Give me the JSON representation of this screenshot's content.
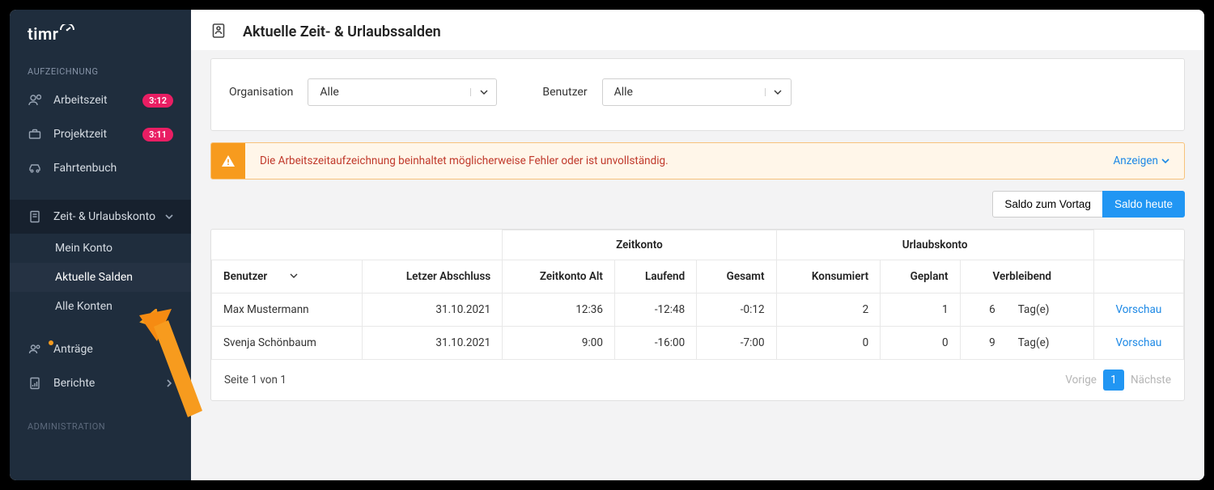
{
  "brand": "timr",
  "sidebar": {
    "sections": {
      "recording": "AUFZEICHNUNG",
      "administration": "ADMINISTRATION"
    },
    "items": {
      "arbeitszeit": {
        "label": "Arbeitszeit",
        "badge": "3:12"
      },
      "projektzeit": {
        "label": "Projektzeit",
        "badge": "3:11"
      },
      "fahrtenbuch": {
        "label": "Fahrtenbuch"
      },
      "zeit_urlaub": {
        "label": "Zeit- & Urlaubskonto"
      },
      "sub_mein_konto": {
        "label": "Mein Konto"
      },
      "sub_aktuelle_salden": {
        "label": "Aktuelle Salden"
      },
      "sub_alle_konten": {
        "label": "Alle Konten"
      },
      "antraege": {
        "label": "Anträge"
      },
      "berichte": {
        "label": "Berichte"
      }
    }
  },
  "page": {
    "title": "Aktuelle Zeit- & Urlaubssalden"
  },
  "filters": {
    "organisation_label": "Organisation",
    "organisation_value": "Alle",
    "benutzer_label": "Benutzer",
    "benutzer_value": "Alle"
  },
  "alert": {
    "message": "Die Arbeitszeitaufzeichnung beinhaltet möglicherweise Fehler oder ist unvollständig.",
    "action": "Anzeigen"
  },
  "toggle": {
    "prev": "Saldo zum Vortag",
    "today": "Saldo heute"
  },
  "table": {
    "group_zeit": "Zeitkonto",
    "group_urlaub": "Urlaubskonto",
    "cols": {
      "benutzer": "Benutzer",
      "letzter_abschluss": "Letzer Abschluss",
      "zeit_alt": "Zeitkonto Alt",
      "laufend": "Laufend",
      "gesamt": "Gesamt",
      "konsumiert": "Konsumiert",
      "geplant": "Geplant",
      "verbleibend": "Verbleibend"
    },
    "rows": [
      {
        "benutzer": "Max Mustermann",
        "abschluss": "31.10.2021",
        "alt": "12:36",
        "laufend": "-12:48",
        "gesamt": "-0:12",
        "konsumiert": "2",
        "geplant": "1",
        "verbleibend": "6",
        "unit": "Tag(e)",
        "action": "Vorschau"
      },
      {
        "benutzer": "Svenja Schönbaum",
        "abschluss": "31.10.2021",
        "alt": "9:00",
        "laufend": "-16:00",
        "gesamt": "-7:00",
        "konsumiert": "0",
        "geplant": "0",
        "verbleibend": "9",
        "unit": "Tag(e)",
        "action": "Vorschau"
      }
    ],
    "footer": {
      "page_info": "Seite 1 von 1",
      "prev": "Vorige",
      "page_num": "1",
      "next": "Nächste"
    }
  }
}
